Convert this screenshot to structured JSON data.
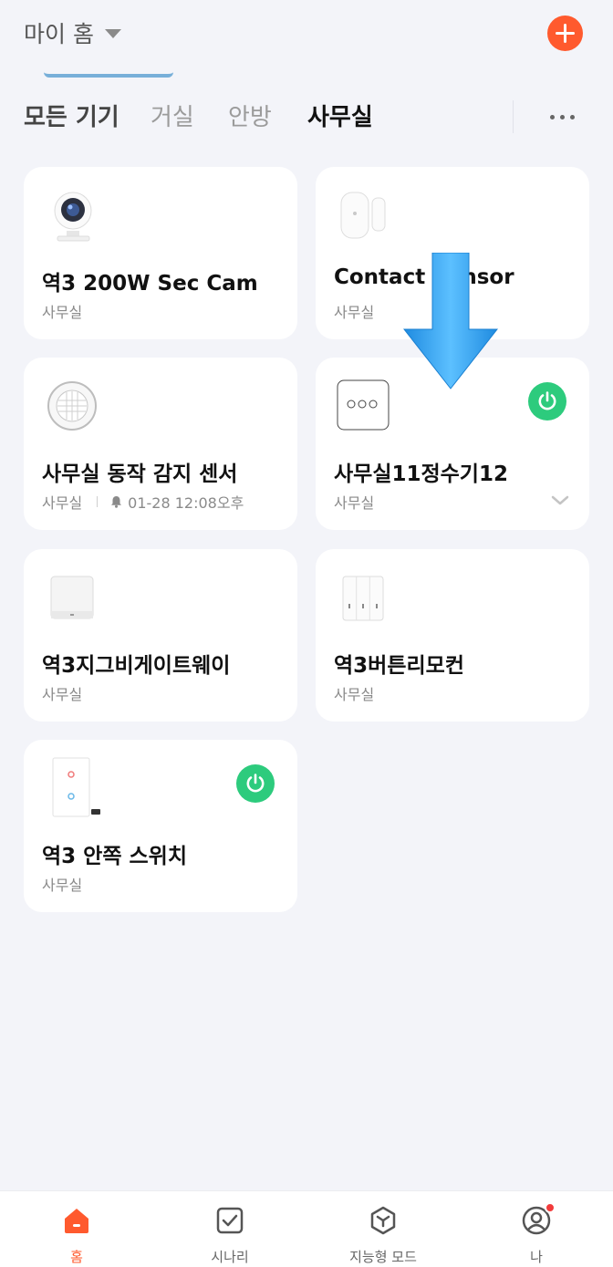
{
  "header": {
    "home_label": "마이 홈"
  },
  "tabs": [
    {
      "label": "모든 기기"
    },
    {
      "label": "거실"
    },
    {
      "label": "안방"
    },
    {
      "label": "사무실",
      "active": true
    }
  ],
  "devices": [
    {
      "name": "역3 200W Sec Cam",
      "room": "사무실",
      "icon": "camera-icon"
    },
    {
      "name": "Contact Sensor",
      "room": "사무실",
      "icon": "contact-sensor-icon"
    },
    {
      "name": "사무실 동작 감지 센서",
      "room": "사무실",
      "event": "01-28 12:08오후",
      "icon": "motion-sensor-icon"
    },
    {
      "name": "사무실11정수기12",
      "room": "사무실",
      "icon": "three-dot-device-icon",
      "power": "on"
    },
    {
      "name": "역3지그비게이트웨이",
      "room": "사무실",
      "icon": "gateway-icon"
    },
    {
      "name": "역3버튼리모컨",
      "room": "사무실",
      "icon": "button-remote-icon"
    },
    {
      "name": "역3 안쪽 스위치",
      "room": "사무실",
      "icon": "wall-switch-icon",
      "power": "on"
    }
  ],
  "bottom_nav": [
    {
      "label": "홈",
      "icon": "home-icon",
      "active": true
    },
    {
      "label": "시나리",
      "icon": "checkbox-icon"
    },
    {
      "label": "지능형 모드",
      "icon": "cube-icon"
    },
    {
      "label": "나",
      "icon": "profile-icon",
      "badge": true
    }
  ],
  "colors": {
    "accent": "#ff5a2e",
    "power_on": "#2dcb7d",
    "background": "#f3f4f9",
    "arrow": "#3aa6f0"
  }
}
